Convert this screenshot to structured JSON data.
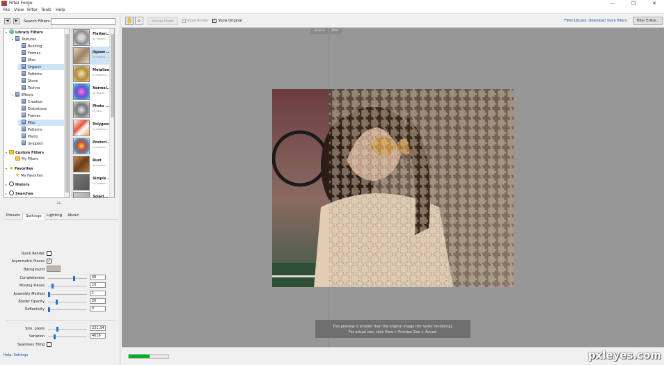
{
  "app": {
    "title": "Filter Forge"
  },
  "menu": [
    "File",
    "View",
    "Filter",
    "Tools",
    "Help"
  ],
  "window_controls": {
    "minimize": "—",
    "maximize": "❐",
    "close": "✕"
  },
  "search": {
    "label": "Search Filters:",
    "value": ""
  },
  "tree": [
    {
      "label": "Library Filters",
      "depth": 0,
      "kind": "lib",
      "bold": true,
      "expand": "▾"
    },
    {
      "label": "Textures",
      "depth": 1,
      "kind": "cat",
      "expand": "▾"
    },
    {
      "label": "Building",
      "depth": 2,
      "kind": "cat"
    },
    {
      "label": "Frames",
      "depth": 2,
      "kind": "cat"
    },
    {
      "label": "Misc",
      "depth": 2,
      "kind": "cat"
    },
    {
      "label": "Organic",
      "depth": 2,
      "kind": "cat",
      "selected": true
    },
    {
      "label": "Patterns",
      "depth": 2,
      "kind": "cat"
    },
    {
      "label": "Stone",
      "depth": 2,
      "kind": "cat"
    },
    {
      "label": "Techno",
      "depth": 2,
      "kind": "cat"
    },
    {
      "label": "Effects",
      "depth": 1,
      "kind": "cat",
      "expand": "▾"
    },
    {
      "label": "Creative",
      "depth": 2,
      "kind": "cat"
    },
    {
      "label": "Distortions",
      "depth": 2,
      "kind": "cat"
    },
    {
      "label": "Frames",
      "depth": 2,
      "kind": "cat"
    },
    {
      "label": "Misc",
      "depth": 2,
      "kind": "cat",
      "selected": true
    },
    {
      "label": "Patterns",
      "depth": 2,
      "kind": "cat"
    },
    {
      "label": "Photo",
      "depth": 2,
      "kind": "cat"
    },
    {
      "label": "Snippets",
      "depth": 2,
      "kind": "cat"
    },
    {
      "label": "Custom Filters",
      "depth": 0,
      "kind": "folder",
      "bold": true,
      "expand": "▾"
    },
    {
      "label": "My Filters",
      "depth": 1,
      "kind": "folder"
    },
    {
      "label": "Favorites",
      "depth": 0,
      "kind": "star",
      "bold": true,
      "expand": "▾"
    },
    {
      "label": "My Favorites",
      "depth": 1,
      "kind": "star"
    },
    {
      "label": "History",
      "depth": 0,
      "kind": "clock",
      "bold": true,
      "expand": "▸"
    },
    {
      "label": "Searches",
      "depth": 0,
      "kind": "mag",
      "bold": true,
      "expand": "▸"
    }
  ],
  "filters": [
    {
      "name": "Flatten...",
      "author": "by Vladimi...",
      "thumb": "radial-gradient(circle,#d9d9d9 20%,#8a8a8a 60%,#e7e7e7)"
    },
    {
      "name": "Jigsaw ...",
      "author": "by Ingvina...",
      "thumb": "linear-gradient(135deg,#e2d3b9,#9c8262,#e8dcc6)",
      "selected": true
    },
    {
      "name": "Metalizer",
      "author": "by Kalamut...",
      "thumb": "radial-gradient(circle,#f6e7b0,#b08a3b 55%,#e7d19a)"
    },
    {
      "name": "Normal...",
      "author": "by Sigma...",
      "thumb": "radial-gradient(circle,#ff7be0,#7a4bd6 45%,#3a9ad6 75%,#69e0ff)"
    },
    {
      "name": "Photo ...",
      "author": "by Seer...",
      "thumb": "radial-gradient(circle,#e8e8e8,#777 50%,#ddd)"
    },
    {
      "name": "Polygons",
      "author": "by Kalamut...",
      "thumb": "linear-gradient(135deg,#fff,#e3543a 40%,#fff 60%,#f0a24a)"
    },
    {
      "name": "Posteri...",
      "author": "by Vladimi...",
      "thumb": "radial-gradient(circle,#f5c76b,#c24e2a 40%,#4a8ac9 70%,#fff)"
    },
    {
      "name": "Rust",
      "author": "by Vladimi...",
      "thumb": "linear-gradient(135deg,#c98d4a,#6e3c1c,#b07a3f)"
    },
    {
      "name": "Simple ...",
      "author": "by Vladimi...",
      "thumb": "linear-gradient(135deg,#777,#555)"
    },
    {
      "name": "Solari...",
      "author": "by ...",
      "thumb": "linear-gradient(135deg,#ccc,#999)"
    }
  ],
  "tabs": [
    "Presets",
    "Settings",
    "Lighting",
    "About"
  ],
  "params": {
    "quick_render": {
      "label": "Quick Render",
      "checked": false
    },
    "asym": {
      "label": "Asymmetric Pieces",
      "checked": true
    },
    "background": {
      "label": "Background"
    },
    "completeness": {
      "label": "Completeness",
      "value": "68",
      "level": 0.68
    },
    "missing": {
      "label": "Missing Pieces",
      "value": "10",
      "level": 0.1
    },
    "assembly": {
      "label": "Assembly Method",
      "value": "1",
      "level": 0.0
    },
    "opacity": {
      "label": "Border Opacity",
      "value": "20",
      "level": 0.2
    },
    "reflect": {
      "label": "Reflectivity",
      "value": "0",
      "level": 0.0
    },
    "size": {
      "label": "Size, pixels",
      "value": "231,34",
      "level": 0.23
    },
    "variation": {
      "label": "Variation",
      "value": "4616",
      "level": 0.15
    },
    "seamless": {
      "label": "Seamless Tiling",
      "checked": false
    }
  },
  "help": "Help: Settings",
  "toolbar": {
    "actual_pixels": "Actual Pixels",
    "show_border": "Show Border",
    "show_original": "Show Original",
    "library_link": "Filter Library: Download more filters",
    "editor": "Filter Editor..."
  },
  "preview": {
    "before": "Before",
    "after": "After",
    "info_line1": "This preview is smaller than the original image (for faster rendering).",
    "info_line2": "For actual size, click View > Preview Size > Actual."
  },
  "progress": 0.52,
  "watermark": "pxleyes.com"
}
